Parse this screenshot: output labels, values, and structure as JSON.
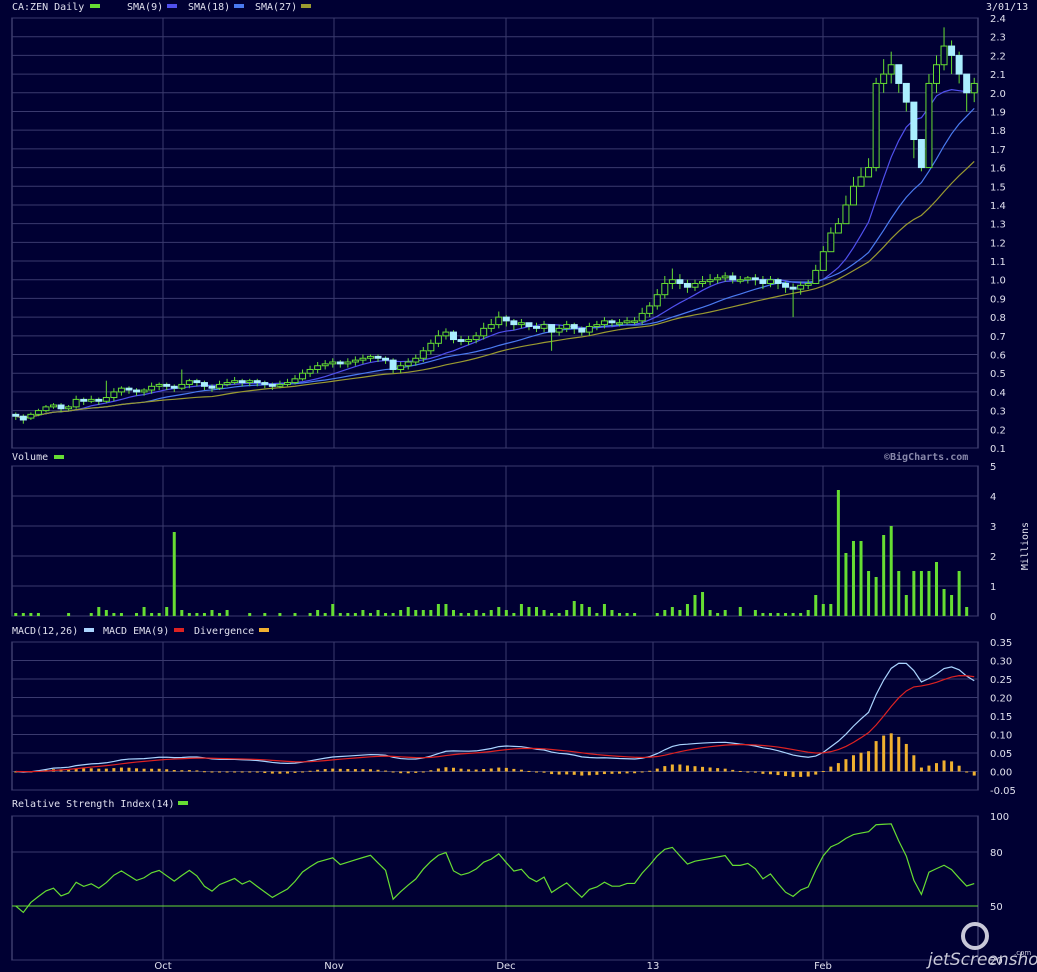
{
  "header": {
    "symbol_label": "CA:ZEN Daily",
    "date": "3/01/13",
    "legend": [
      {
        "label": "SMA(9)",
        "color": "#5050ee"
      },
      {
        "label": "SMA(18)",
        "color": "#4a7af0"
      },
      {
        "label": "SMA(27)",
        "color": "#9a9a30"
      }
    ],
    "symbol_swatch": "#66dd33"
  },
  "volume_panel": {
    "title": "Volume",
    "watermark": "©BigCharts.com",
    "units_label": "Millions"
  },
  "macd_panel": {
    "legend": [
      {
        "label": "MACD(12,26)",
        "color": "#aad4ff"
      },
      {
        "label": "MACD EMA(9)",
        "color": "#dd2222"
      },
      {
        "label": "Divergence",
        "color": "#f0b030"
      }
    ]
  },
  "rsi_panel": {
    "title": "Relative Strength Index(14)",
    "swatch": "#66dd33"
  },
  "x_axis": {
    "months": [
      "Oct",
      "Nov",
      "Dec",
      "13",
      "Feb"
    ]
  },
  "footer": {
    "logo_text": "jetScreenshot",
    "logo_suffix": ".com"
  },
  "chart_data": [
    {
      "type": "candlestick",
      "name": "price",
      "ylim": [
        0.1,
        2.4
      ],
      "yticks": [
        "2.4",
        "2.3",
        "2.2",
        "2.1",
        "2.0",
        "1.9",
        "1.8",
        "1.7",
        "1.6",
        "1.5",
        "1.4",
        "1.3",
        "1.2",
        "1.1",
        "1.0",
        "0.9",
        "0.8",
        "0.7",
        "0.6",
        "0.5",
        "0.4",
        "0.3",
        "0.2",
        "0.1"
      ],
      "close": [
        0.27,
        0.25,
        0.28,
        0.3,
        0.32,
        0.33,
        0.31,
        0.32,
        0.36,
        0.35,
        0.36,
        0.35,
        0.37,
        0.4,
        0.42,
        0.41,
        0.4,
        0.41,
        0.43,
        0.44,
        0.43,
        0.42,
        0.44,
        0.46,
        0.45,
        0.43,
        0.42,
        0.44,
        0.45,
        0.46,
        0.45,
        0.46,
        0.45,
        0.44,
        0.43,
        0.44,
        0.45,
        0.47,
        0.5,
        0.52,
        0.54,
        0.55,
        0.56,
        0.55,
        0.56,
        0.57,
        0.58,
        0.59,
        0.58,
        0.57,
        0.52,
        0.54,
        0.56,
        0.58,
        0.62,
        0.66,
        0.7,
        0.72,
        0.68,
        0.67,
        0.68,
        0.7,
        0.74,
        0.76,
        0.8,
        0.78,
        0.76,
        0.77,
        0.75,
        0.74,
        0.76,
        0.72,
        0.74,
        0.76,
        0.74,
        0.72,
        0.75,
        0.76,
        0.78,
        0.77,
        0.77,
        0.78,
        0.78,
        0.82,
        0.86,
        0.92,
        0.98,
        1.0,
        0.98,
        0.96,
        0.98,
        0.99,
        1.0,
        1.01,
        1.02,
        1.0,
        1.0,
        1.01,
        1.0,
        0.98,
        1.0,
        0.98,
        0.96,
        0.95,
        0.97,
        0.98,
        1.05,
        1.15,
        1.25,
        1.3,
        1.4,
        1.5,
        1.55,
        1.6,
        2.05,
        2.1,
        2.15,
        2.05,
        1.95,
        1.75,
        1.6,
        2.05,
        2.15,
        2.25,
        2.2,
        2.1,
        2.0,
        2.05
      ],
      "open": [
        0.28,
        0.27,
        0.26,
        0.28,
        0.3,
        0.32,
        0.33,
        0.31,
        0.32,
        0.36,
        0.35,
        0.36,
        0.35,
        0.37,
        0.4,
        0.42,
        0.41,
        0.4,
        0.41,
        0.43,
        0.44,
        0.43,
        0.42,
        0.44,
        0.46,
        0.45,
        0.43,
        0.42,
        0.44,
        0.45,
        0.46,
        0.45,
        0.46,
        0.45,
        0.44,
        0.43,
        0.44,
        0.45,
        0.47,
        0.5,
        0.52,
        0.54,
        0.55,
        0.56,
        0.55,
        0.56,
        0.57,
        0.58,
        0.59,
        0.58,
        0.57,
        0.52,
        0.54,
        0.56,
        0.58,
        0.62,
        0.66,
        0.7,
        0.72,
        0.68,
        0.67,
        0.68,
        0.7,
        0.74,
        0.76,
        0.8,
        0.78,
        0.76,
        0.77,
        0.75,
        0.74,
        0.76,
        0.72,
        0.74,
        0.76,
        0.74,
        0.72,
        0.75,
        0.76,
        0.78,
        0.77,
        0.77,
        0.78,
        0.78,
        0.82,
        0.86,
        0.92,
        0.98,
        1.0,
        0.98,
        0.96,
        0.98,
        0.99,
        1.0,
        1.01,
        1.02,
        1.0,
        1.0,
        1.01,
        1.0,
        0.98,
        1.0,
        0.98,
        0.96,
        0.95,
        0.97,
        0.98,
        1.05,
        1.15,
        1.25,
        1.3,
        1.4,
        1.5,
        1.55,
        1.6,
        2.05,
        2.1,
        2.15,
        2.05,
        1.95,
        1.75,
        1.6,
        2.05,
        2.15,
        2.25,
        2.2,
        2.1,
        2.0
      ],
      "high": [
        0.29,
        0.28,
        0.29,
        0.31,
        0.33,
        0.34,
        0.34,
        0.33,
        0.38,
        0.37,
        0.38,
        0.37,
        0.46,
        0.42,
        0.43,
        0.43,
        0.42,
        0.42,
        0.45,
        0.45,
        0.45,
        0.44,
        0.52,
        0.47,
        0.47,
        0.46,
        0.44,
        0.46,
        0.47,
        0.48,
        0.47,
        0.47,
        0.47,
        0.46,
        0.45,
        0.46,
        0.47,
        0.49,
        0.52,
        0.54,
        0.56,
        0.57,
        0.58,
        0.57,
        0.58,
        0.59,
        0.6,
        0.6,
        0.6,
        0.59,
        0.58,
        0.56,
        0.58,
        0.6,
        0.64,
        0.68,
        0.73,
        0.74,
        0.73,
        0.7,
        0.7,
        0.72,
        0.77,
        0.79,
        0.83,
        0.81,
        0.79,
        0.79,
        0.77,
        0.77,
        0.78,
        0.75,
        0.76,
        0.78,
        0.77,
        0.75,
        0.77,
        0.78,
        0.8,
        0.79,
        0.79,
        0.8,
        0.8,
        0.85,
        0.88,
        0.95,
        1.02,
        1.06,
        1.03,
        1.0,
        1.0,
        1.02,
        1.03,
        1.03,
        1.04,
        1.04,
        1.02,
        1.02,
        1.03,
        1.02,
        1.02,
        1.01,
        0.99,
        0.98,
        0.99,
        1.0,
        1.08,
        1.18,
        1.28,
        1.33,
        1.45,
        1.55,
        1.6,
        1.65,
        2.08,
        2.18,
        2.22,
        2.12,
        2.0,
        1.85,
        1.72,
        2.1,
        2.2,
        2.35,
        2.28,
        2.22,
        2.1,
        2.08
      ],
      "low": [
        0.25,
        0.23,
        0.25,
        0.27,
        0.29,
        0.31,
        0.29,
        0.3,
        0.31,
        0.33,
        0.34,
        0.33,
        0.34,
        0.35,
        0.38,
        0.39,
        0.38,
        0.38,
        0.39,
        0.41,
        0.41,
        0.4,
        0.41,
        0.42,
        0.43,
        0.41,
        0.4,
        0.41,
        0.43,
        0.44,
        0.43,
        0.43,
        0.43,
        0.42,
        0.41,
        0.42,
        0.43,
        0.44,
        0.46,
        0.48,
        0.5,
        0.52,
        0.53,
        0.53,
        0.53,
        0.54,
        0.55,
        0.56,
        0.56,
        0.55,
        0.5,
        0.5,
        0.52,
        0.54,
        0.56,
        0.6,
        0.64,
        0.68,
        0.66,
        0.65,
        0.65,
        0.66,
        0.68,
        0.72,
        0.74,
        0.75,
        0.73,
        0.74,
        0.73,
        0.72,
        0.72,
        0.62,
        0.7,
        0.72,
        0.71,
        0.7,
        0.7,
        0.73,
        0.74,
        0.75,
        0.75,
        0.76,
        0.76,
        0.76,
        0.8,
        0.84,
        0.9,
        0.95,
        0.95,
        0.93,
        0.94,
        0.96,
        0.97,
        0.98,
        0.99,
        0.98,
        0.98,
        0.98,
        0.97,
        0.95,
        0.96,
        0.95,
        0.93,
        0.8,
        0.92,
        0.95,
        1.0,
        1.12,
        1.2,
        1.25,
        1.35,
        1.45,
        1.5,
        1.55,
        1.58,
        2.0,
        2.05,
        2.0,
        1.9,
        1.65,
        1.58,
        1.6,
        2.0,
        2.12,
        2.1,
        2.05,
        1.9,
        1.95
      ]
    },
    {
      "type": "line",
      "name": "moving-averages",
      "series": [
        {
          "name": "SMA(9)",
          "color": "#5050ee"
        },
        {
          "name": "SMA(18)",
          "color": "#4a7af0"
        },
        {
          "name": "SMA(27)",
          "color": "#9a9a30"
        }
      ]
    },
    {
      "type": "bar",
      "name": "volume",
      "ylim": [
        0,
        5
      ],
      "yticks": [
        "5",
        "4",
        "3",
        "2",
        "1",
        "0"
      ],
      "values": [
        0.1,
        0.1,
        0.1,
        0.1,
        0.0,
        0.0,
        0.0,
        0.1,
        0.0,
        0.0,
        0.1,
        0.3,
        0.2,
        0.1,
        0.1,
        0.0,
        0.1,
        0.3,
        0.1,
        0.1,
        0.3,
        2.8,
        0.2,
        0.1,
        0.1,
        0.1,
        0.2,
        0.1,
        0.2,
        0.0,
        0.0,
        0.1,
        0.0,
        0.1,
        0.0,
        0.1,
        0.0,
        0.1,
        0.0,
        0.1,
        0.2,
        0.1,
        0.4,
        0.1,
        0.1,
        0.1,
        0.2,
        0.1,
        0.2,
        0.1,
        0.1,
        0.2,
        0.3,
        0.2,
        0.2,
        0.2,
        0.4,
        0.4,
        0.2,
        0.1,
        0.1,
        0.2,
        0.1,
        0.2,
        0.3,
        0.2,
        0.1,
        0.4,
        0.3,
        0.3,
        0.2,
        0.1,
        0.1,
        0.2,
        0.5,
        0.4,
        0.3,
        0.1,
        0.4,
        0.2,
        0.1,
        0.1,
        0.1,
        0.0,
        0.0,
        0.1,
        0.2,
        0.3,
        0.2,
        0.4,
        0.7,
        0.8,
        0.2,
        0.1,
        0.2,
        0.0,
        0.3,
        0.0,
        0.2,
        0.1,
        0.1,
        0.1,
        0.1,
        0.1,
        0.1,
        0.2,
        0.7,
        0.4,
        0.4,
        4.2,
        2.1,
        2.5,
        2.5,
        1.5,
        1.3,
        2.7,
        3.0,
        1.5,
        0.7,
        1.5,
        1.5,
        1.5,
        1.8,
        0.9,
        0.7,
        1.5,
        0.3
      ]
    },
    {
      "type": "line",
      "name": "macd",
      "ylim": [
        -0.05,
        0.35
      ],
      "yticks": [
        "0.35",
        "0.30",
        "0.25",
        "0.20",
        "0.15",
        "0.10",
        "0.05",
        "0.00",
        "-0.05"
      ]
    },
    {
      "type": "line",
      "name": "rsi",
      "ylim": [
        20,
        100
      ],
      "yticks": [
        "100",
        "80",
        "50",
        "20"
      ],
      "reference_level": 50
    }
  ]
}
